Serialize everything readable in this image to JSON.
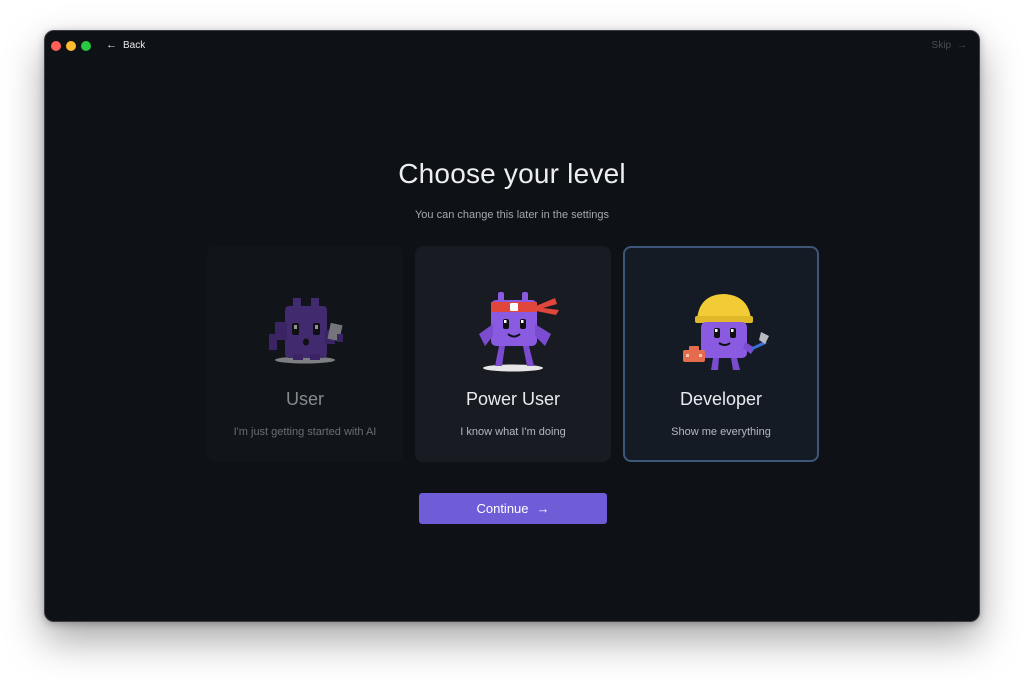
{
  "nav": {
    "back_label": "Back",
    "skip_label": "Skip"
  },
  "header": {
    "title": "Choose your level",
    "subtitle": "You can change this later in the settings"
  },
  "levels": [
    {
      "title": "User",
      "description": "I'm just getting started with AI",
      "selected": false,
      "icon": "user-mascot-icon"
    },
    {
      "title": "Power User",
      "description": "I know what I'm doing",
      "selected": false,
      "icon": "power-user-mascot-icon"
    },
    {
      "title": "Developer",
      "description": "Show me everything",
      "selected": true,
      "icon": "developer-mascot-icon"
    }
  ],
  "continue_label": "Continue",
  "colors": {
    "window_bg": "#0e1116",
    "accent": "#6f5dd8",
    "selected_border": "#3e5678",
    "mascot": "#7a4fc9"
  }
}
